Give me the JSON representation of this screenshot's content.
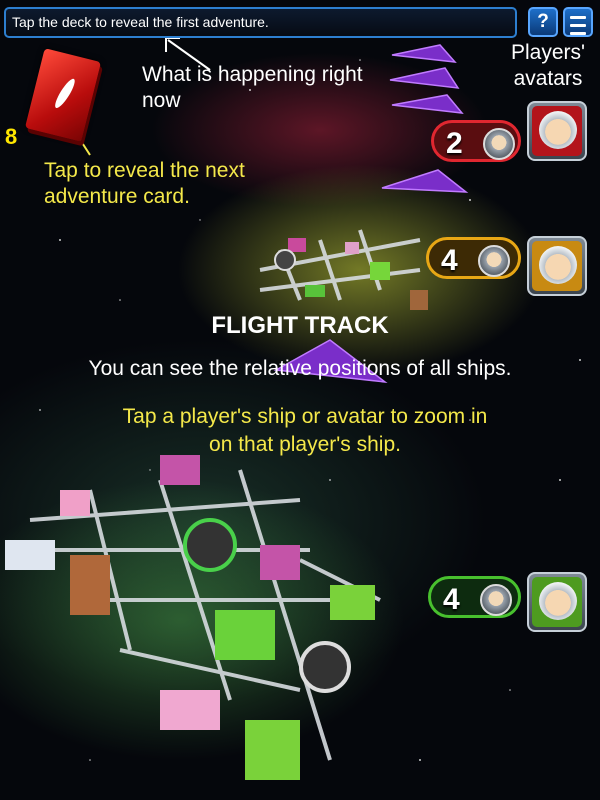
{
  "status_bar": {
    "message": "Tap the deck to reveal the first adventure."
  },
  "buttons": {
    "help_label": "?"
  },
  "deck": {
    "remaining_count": "8"
  },
  "annotations": {
    "status_hint": "What is happening right now",
    "deck_hint": "Tap to reveal the next adventure card.",
    "avatars_hint": "Players' avatars",
    "flight_track_title": "FLIGHT TRACK",
    "flight_track_desc": "You can see the relative positions of all ships.",
    "zoom_hint": "Tap a player's ship or avatar to zoom in on that player's ship."
  },
  "players": [
    {
      "position": "2",
      "color": "#e02730"
    },
    {
      "position": "4",
      "color": "#e8a715"
    },
    {
      "position": "4",
      "color": "#48c02e"
    }
  ],
  "icons": [
    "help-icon",
    "menu-icon",
    "arrow-icon"
  ]
}
